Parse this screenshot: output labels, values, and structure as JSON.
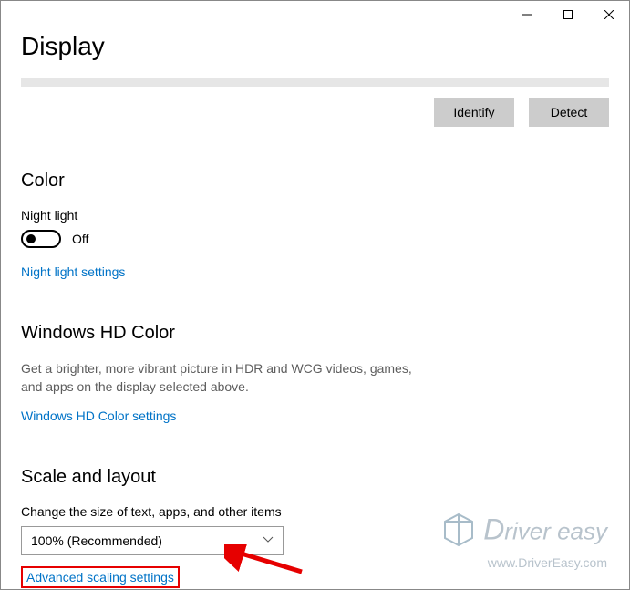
{
  "page": {
    "title": "Display"
  },
  "buttons": {
    "identify": "Identify",
    "detect": "Detect"
  },
  "color": {
    "heading": "Color",
    "night_light_label": "Night light",
    "night_light_state": "Off",
    "night_light_settings_link": "Night light settings"
  },
  "hd": {
    "heading": "Windows HD Color",
    "description": "Get a brighter, more vibrant picture in HDR and WCG videos, games, and apps on the display selected above.",
    "settings_link": "Windows HD Color settings"
  },
  "scale": {
    "heading": "Scale and layout",
    "change_size_label": "Change the size of text, apps, and other items",
    "dropdown_value": "100% (Recommended)",
    "advanced_link": "Advanced scaling settings"
  },
  "watermark": {
    "brand_prefix": "D",
    "brand_rest": "river easy",
    "url": "www.DriverEasy.com"
  }
}
